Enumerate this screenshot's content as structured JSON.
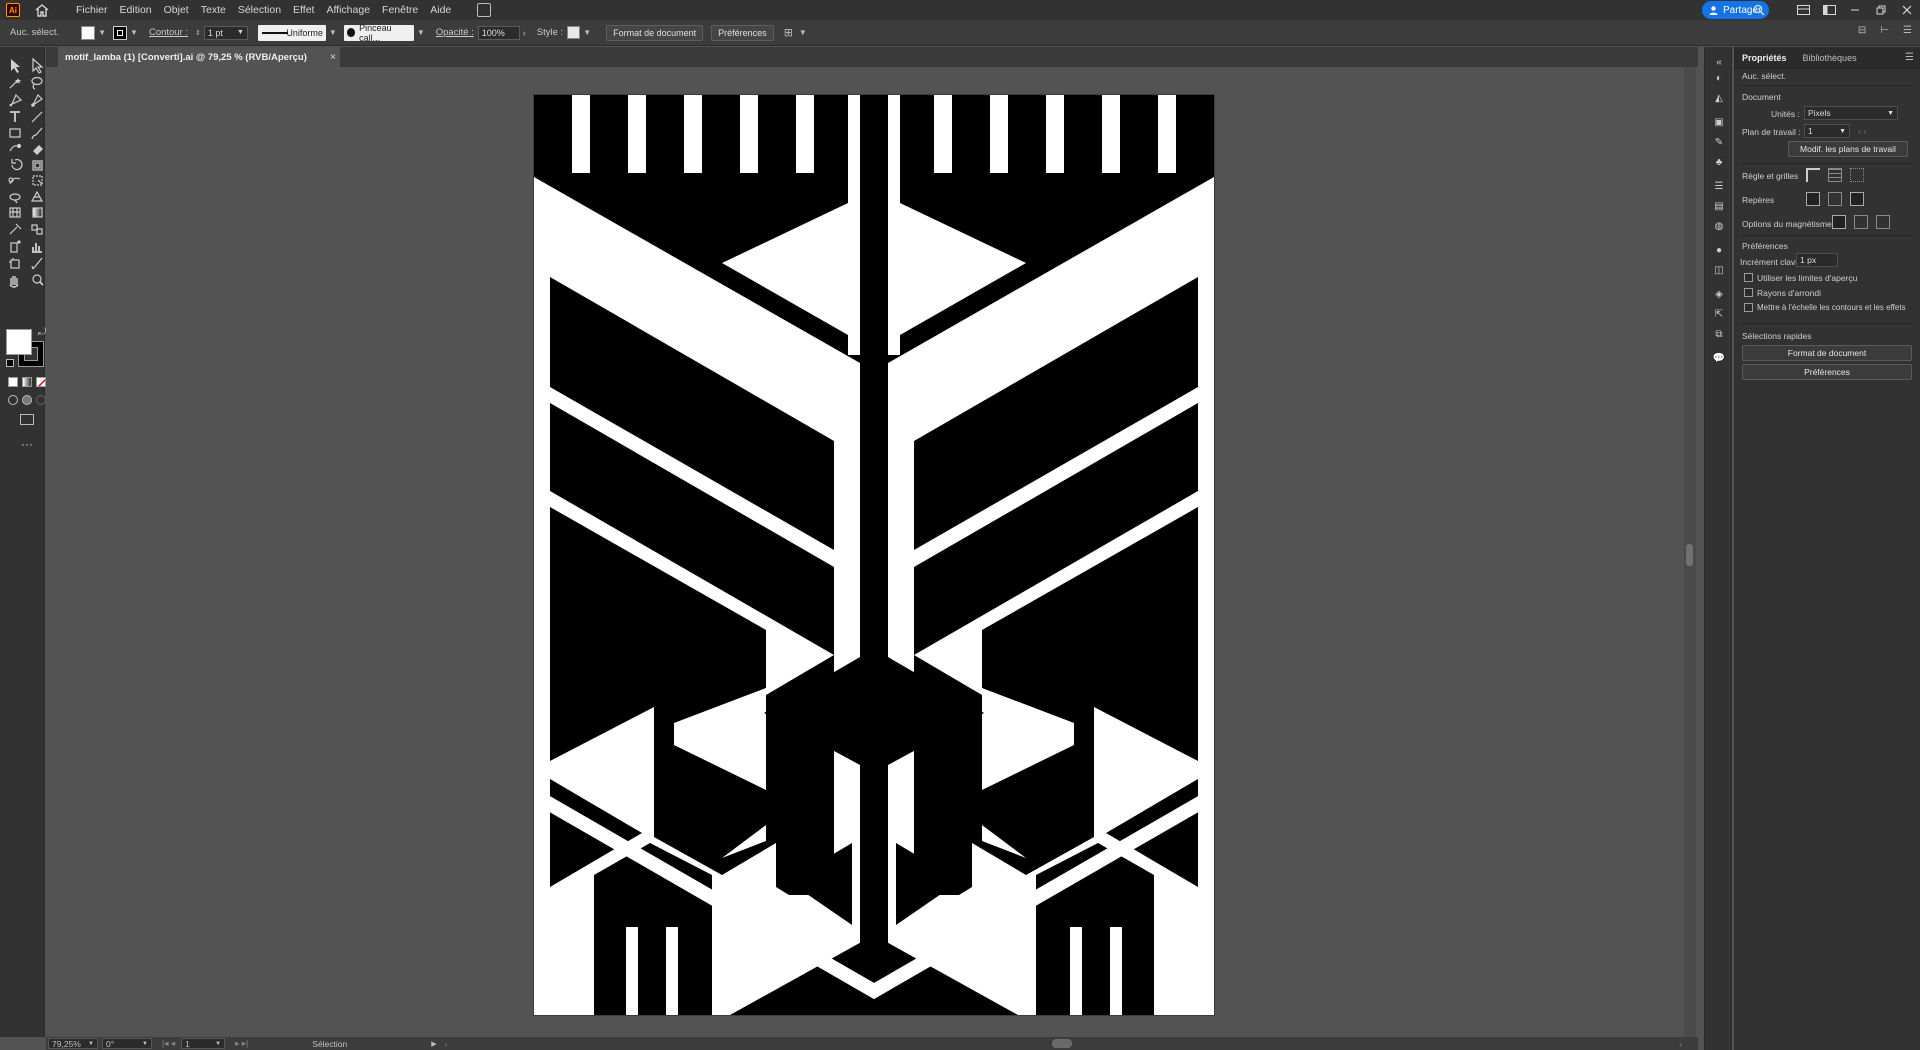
{
  "app": {
    "logo": "Ai"
  },
  "menu": [
    "Fichier",
    "Edition",
    "Objet",
    "Texte",
    "Sélection",
    "Effet",
    "Affichage",
    "Fenêtre",
    "Aide"
  ],
  "share": {
    "label": "Partager"
  },
  "controlbar": {
    "selection": "Auc. sélect.",
    "contour_label": "Contour :",
    "contour_value": "1 pt",
    "stroke_profile": "Uniforme",
    "brush": "Pinceau call...",
    "opacity_label": "Opacité :",
    "opacity_value": "100%",
    "style_label": "Style :",
    "doc_format_btn": "Format de document",
    "prefs_btn": "Préférences"
  },
  "document": {
    "tab_title": "motif_lamba (1) [Converti].ai @ 79,25 % (RVB/Aperçu)",
    "close_glyph": "×"
  },
  "statusbar": {
    "zoom": "79,25%",
    "rotation": "0°",
    "artboard": "1",
    "tool": "Sélection"
  },
  "panel": {
    "tabs": [
      "Propriétés",
      "Bibliothèques"
    ],
    "selection": "Auc. sélect.",
    "document_heading": "Document",
    "units_label": "Unités :",
    "units_value": "Pixels",
    "artboard_label": "Plan de travail :",
    "artboard_value": "1",
    "edit_artboards_btn": "Modif. les plans de travail",
    "rulers_label": "Règle et grilles",
    "guides_label": "Repères",
    "snap_label": "Options du magnétisme",
    "prefs_heading": "Préférences",
    "keyboard_inc_label": "Incrément clavier :",
    "keyboard_inc_value": "1 px",
    "check_preview_bounds": "Utiliser les limites d'aperçu",
    "check_round_corners": "Rayons d'arrondi",
    "check_scale_strokes": "Mettre à l'échelle les contours et les effets",
    "quick_actions_heading": "Sélections rapides",
    "quick_doc_format_btn": "Format de document",
    "quick_prefs_btn": "Préférences"
  },
  "colors": {
    "accent": "#1473e6",
    "app_logo": "#ff9a00",
    "canvas": "#535353",
    "artwork_black": "#000000",
    "artwork_white": "#ffffff"
  },
  "icons": {
    "home": "home-icon",
    "search": "search-icon",
    "close": "close-icon"
  }
}
